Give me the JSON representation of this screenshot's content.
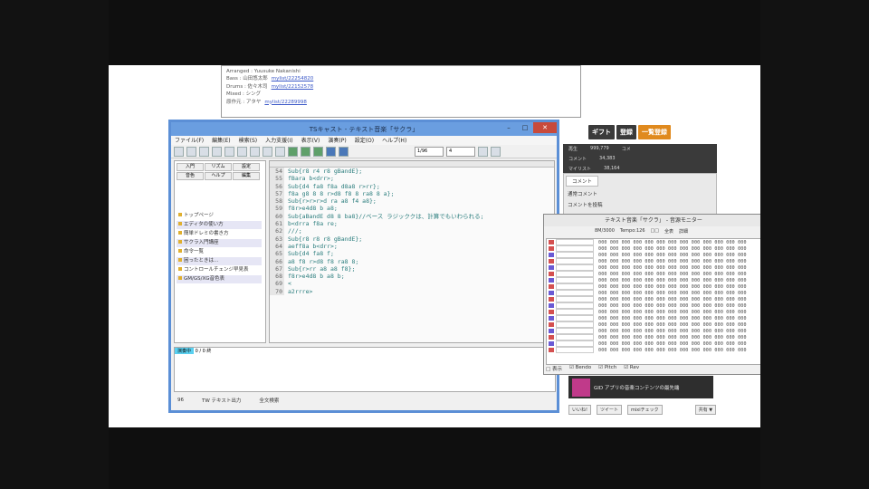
{
  "info": {
    "lines": [
      {
        "label": "Arranged : Yuusuke Nakanishi",
        "link": ""
      },
      {
        "label": "Bass : 山田悠太郎",
        "link": "mylist/22254820"
      },
      {
        "label": "Drums : 佐々木司",
        "link": "mylist/22152578"
      },
      {
        "label": "Mixed : シング",
        "link": ""
      },
      {
        "label": "原作元 : アタヤ",
        "link": "mylist/22289998"
      }
    ]
  },
  "right_panel": {
    "buttons": [
      "ギフト",
      "登録",
      "一覧登録"
    ],
    "buttons_colors": [
      "#3a3a3a",
      "#3a3a3a",
      "#e08a1e"
    ],
    "stats": [
      {
        "label": "再生",
        "value": "999,779",
        "extra": "コメ"
      },
      {
        "label": "コメント",
        "value": "34,383",
        "extra": ""
      },
      {
        "label": "マイリスト",
        "value": "38,164",
        "extra": ""
      }
    ],
    "tabs": [
      "コメント"
    ],
    "fields": [
      "通常コメント",
      "コメントを投稿"
    ]
  },
  "editor_window": {
    "title": "TSキャスト - テキスト音楽「サクラ」",
    "controls": [
      "–",
      "□",
      "✕"
    ],
    "menu": [
      "ファイル(F)",
      "編集(E)",
      "検索(S)",
      "入力支援(I)",
      "表示(V)",
      "演奏(P)",
      "設定(O)",
      "ヘルプ(H)"
    ],
    "toolbar_select_1": "1/96",
    "toolbar_select_2": "4",
    "sidebar_tabs": [
      "入門",
      "リズム",
      "設定",
      "音色",
      "ヘルプ",
      "編集"
    ],
    "sidebar_items": [
      "トップページ",
      "エディタの使い方",
      "簡単ドレミの書き方",
      "サクラ入門講座",
      "命令一覧",
      "困ったときは…",
      "コントロールチェンジ早見表",
      "GM/GS/XG音色表"
    ],
    "code_lines": [
      {
        "n": "54",
        "text": "Sub{r8 r4 r8 gBandE};"
      },
      {
        "n": "55",
        "text": "fBara b<drr>;"
      },
      {
        "n": "56",
        "text": "Sub{d4 fa8 f8a d8a8 r>rr};"
      },
      {
        "n": "57",
        "text": "f8a g8 8 8 r>d8 f8 8 ra8 8 a};"
      },
      {
        "n": "58",
        "text": "Sub{r>r>r>d ra a8 f4 a8};"
      },
      {
        "n": "59",
        "text": "f8r>e4d8 b a8;"
      },
      {
        "n": "60",
        "text": "Sub{aBandE  d8 8 ba8}//ベース ラジッククは、計算でもいわられる;"
      },
      {
        "n": "61",
        "text": "b<drra f8a re;"
      },
      {
        "n": "62",
        "text": "///;"
      },
      {
        "n": "63",
        "text": "Sub{r8 r8 r8 gBandE};"
      },
      {
        "n": "64",
        "text": "aeff8a b<drr>;"
      },
      {
        "n": "65",
        "text": "Sub{d4 fa8 f;"
      },
      {
        "n": "66",
        "text": "a8 f8 r>d8 f8 ra8 8;"
      },
      {
        "n": "67",
        "text": "Sub{r>rr a8 a8 f8};"
      },
      {
        "n": "68",
        "text": "f8r>e4d8 b a8 b;"
      },
      {
        "n": "69",
        "text": "<"
      },
      {
        "n": "70",
        "text": "a2rrre>"
      }
    ],
    "bottom_highlight": "演奏中",
    "bottom_text": "0 / 0  終",
    "status": [
      "96",
      "TW  テキスト出力",
      "全文検索"
    ]
  },
  "monitor_window": {
    "title": "テキスト音楽「サクラ」 - 音源モニター",
    "tools": [
      "8M/3000",
      "Tempo:126",
      "□□",
      "全表",
      "詳細"
    ],
    "rows": [
      {
        "marker": "#d45050",
        "values": "000 000 000 000 000 000 000 000 000 000 000 000 000"
      },
      {
        "marker": "#d45050",
        "values": "000 000 000 000 000 000 000 000 000 000 000 000 000"
      },
      {
        "marker": "#6a5ad4",
        "values": "000 000 000 000 000 000 000 000 000 000 000 000 000"
      },
      {
        "marker": "#d45050",
        "values": "000 000 000 000 000 000 000 000 000 000 000 000 000"
      },
      {
        "marker": "#6a5ad4",
        "values": "000 000 000 000 000 000 000 000 000 000 000 000 000"
      },
      {
        "marker": "#d45050",
        "values": "000 000 000 000 000 000 000 000 000 000 000 000 000"
      },
      {
        "marker": "#6a5ad4",
        "values": "000 000 000 000 000 000 000 000 000 000 000 000 000"
      },
      {
        "marker": "#d45050",
        "values": "000 000 000 000 000 000 000 000 000 000 000 000 000"
      },
      {
        "marker": "#6a5ad4",
        "values": "000 000 000 000 000 000 000 000 000 000 000 000 000"
      },
      {
        "marker": "#d45050",
        "values": "000 000 000 000 000 000 000 000 000 000 000 000 000"
      },
      {
        "marker": "#6a5ad4",
        "values": "000 000 000 000 000 000 000 000 000 000 000 000 000"
      },
      {
        "marker": "#d45050",
        "values": "000 000 000 000 000 000 000 000 000 000 000 000 000"
      },
      {
        "marker": "#6a5ad4",
        "values": "000 000 000 000 000 000 000 000 000 000 000 000 000"
      },
      {
        "marker": "#d45050",
        "values": "000 000 000 000 000 000 000 000 000 000 000 000 000"
      },
      {
        "marker": "#6a5ad4",
        "values": "000 000 000 000 000 000 000 000 000 000 000 000 000"
      },
      {
        "marker": "#d45050",
        "values": "000 000 000 000 000 000 000 000 000 000 000 000 000"
      },
      {
        "marker": "#6a5ad4",
        "values": "000 000 000 000 000 000 000 000 000 000 000 000 000"
      },
      {
        "marker": "#d45050",
        "values": "000 000 000 000 000 000 000 000 000 000 000 000 000"
      }
    ],
    "footer": [
      "□ 表示",
      "☑ Bendo",
      "☑ Pitch",
      "☑ Rev"
    ]
  },
  "ad": {
    "text": "GID アプリの音楽コンテンツの最先端"
  },
  "share": [
    "いいね!",
    "ツイート",
    "mixiチェック",
    "共有 ▼"
  ]
}
